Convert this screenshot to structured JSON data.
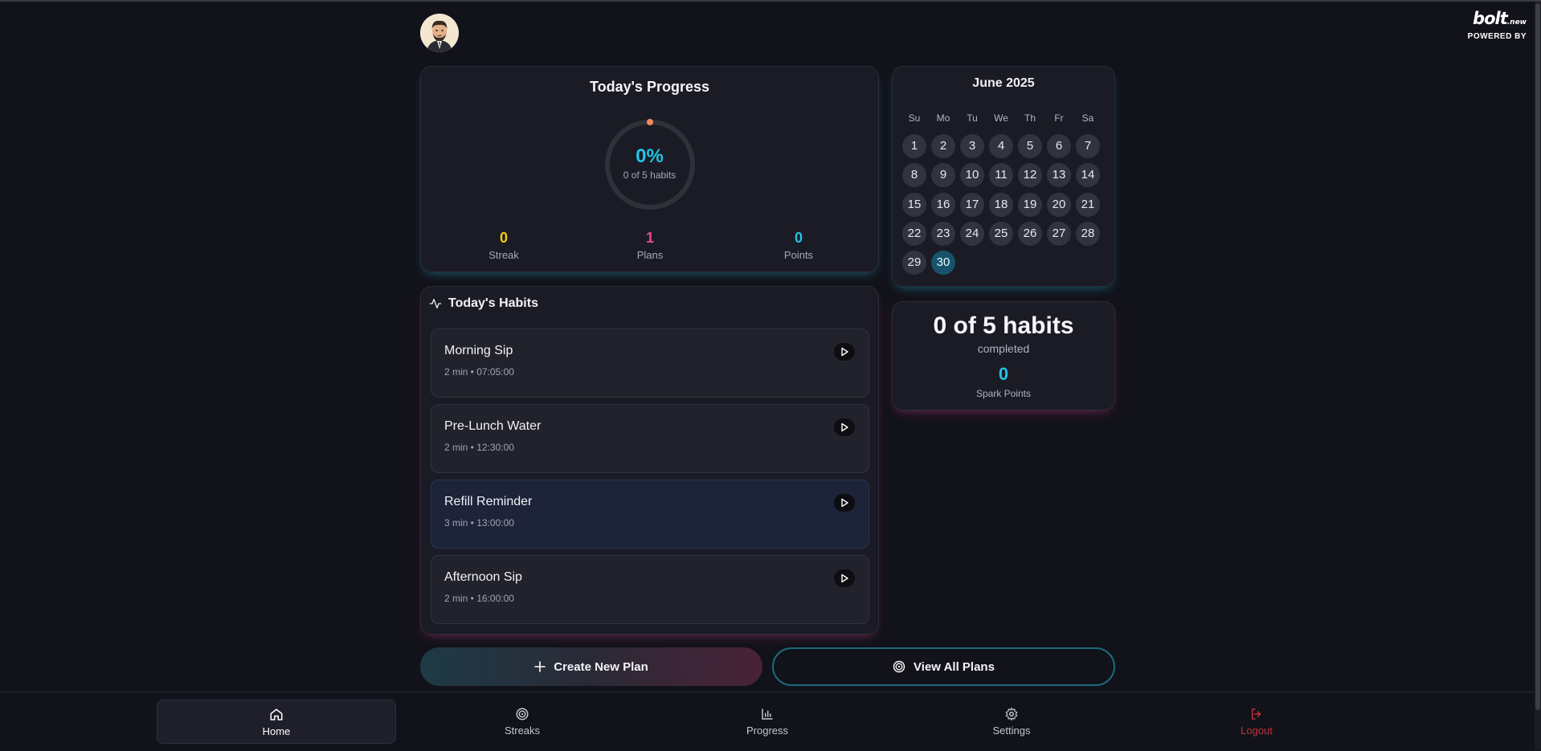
{
  "branding": {
    "logo_text": "bolt",
    "logo_suffix": ".new",
    "powered_by": "POWERED BY"
  },
  "progress": {
    "title": "Today's Progress",
    "percent_label": "0%",
    "percent_value": 0,
    "subtitle": "0 of 5 habits",
    "stats": [
      {
        "value": "0",
        "label": "Streak",
        "color": "#facc15"
      },
      {
        "value": "1",
        "label": "Plans",
        "color": "#ec4899"
      },
      {
        "value": "0",
        "label": "Points",
        "color": "#22c3e6"
      }
    ]
  },
  "calendar": {
    "title": "June 2025",
    "weekdays": [
      "Su",
      "Mo",
      "Tu",
      "We",
      "Th",
      "Fr",
      "Sa"
    ],
    "days": [
      "1",
      "2",
      "3",
      "4",
      "5",
      "6",
      "7",
      "8",
      "9",
      "10",
      "11",
      "12",
      "13",
      "14",
      "15",
      "16",
      "17",
      "18",
      "19",
      "20",
      "21",
      "22",
      "23",
      "24",
      "25",
      "26",
      "27",
      "28",
      "29",
      "30"
    ],
    "today": "30"
  },
  "summary": {
    "headline": "0 of 5 habits",
    "subtitle": "completed",
    "points_value": "0",
    "points_label": "Spark Points"
  },
  "habits": {
    "title": "Today's Habits",
    "items": [
      {
        "name": "Morning Sip",
        "meta": "2 min • 07:05:00"
      },
      {
        "name": "Pre-Lunch Water",
        "meta": "2 min • 12:30:00"
      },
      {
        "name": "Refill Reminder",
        "meta": "3 min • 13:00:00"
      },
      {
        "name": "Afternoon Sip",
        "meta": "2 min • 16:00:00"
      }
    ]
  },
  "actions": {
    "create_label": "Create New Plan",
    "view_label": "View All Plans"
  },
  "nav": {
    "home": "Home",
    "streaks": "Streaks",
    "progress": "Progress",
    "settings": "Settings",
    "logout": "Logout"
  },
  "colors": {
    "accent_cyan": "#22c3e6",
    "accent_pink": "#ec4899",
    "accent_yellow": "#facc15",
    "logout_red": "#c2303b"
  }
}
